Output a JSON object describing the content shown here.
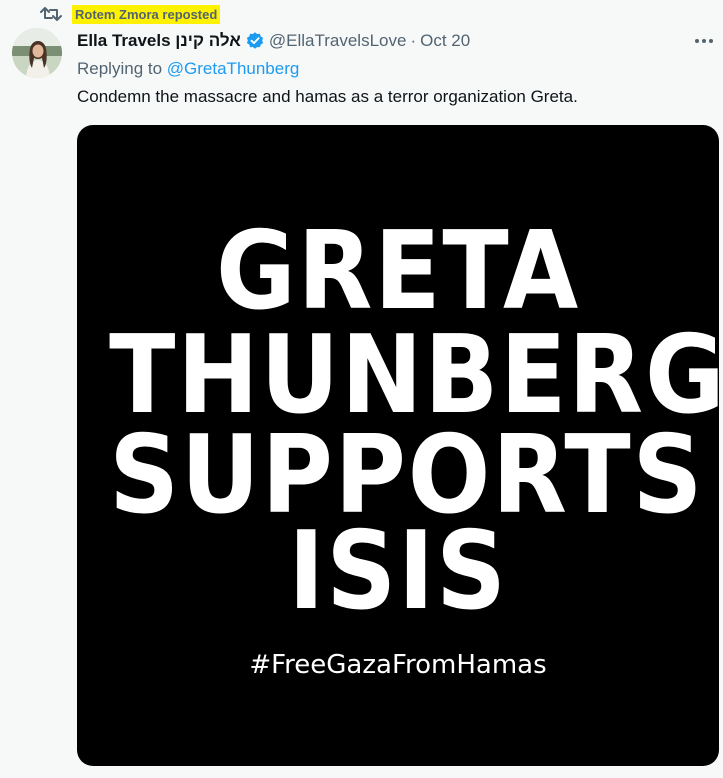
{
  "repost": {
    "text": "Rotem Zmora reposted"
  },
  "tweet": {
    "display_name": "Ella Travels אלה קינן",
    "handle": "@EllaTravelsLove",
    "separator": "·",
    "date": "Oct 20",
    "replying_prefix": "Replying to ",
    "replying_to": "@GretaThunberg",
    "text": "Condemn the massacre and hamas as a terror organization Greta."
  },
  "media": {
    "lines": [
      "GRETA",
      "THUNBERG",
      "SUPPORTS",
      "ISIS"
    ],
    "hashtag": "#FreeGazaFromHamas"
  },
  "icons": {
    "repost": "repost-icon",
    "verified": "verified-badge-icon",
    "more": "more-options-icon"
  },
  "colors": {
    "background": "#f7f9f9",
    "secondary_text": "#536471",
    "link": "#1d9bf0",
    "verified": "#1d9bf0",
    "highlight": "#fff200",
    "media_background": "#000000"
  }
}
